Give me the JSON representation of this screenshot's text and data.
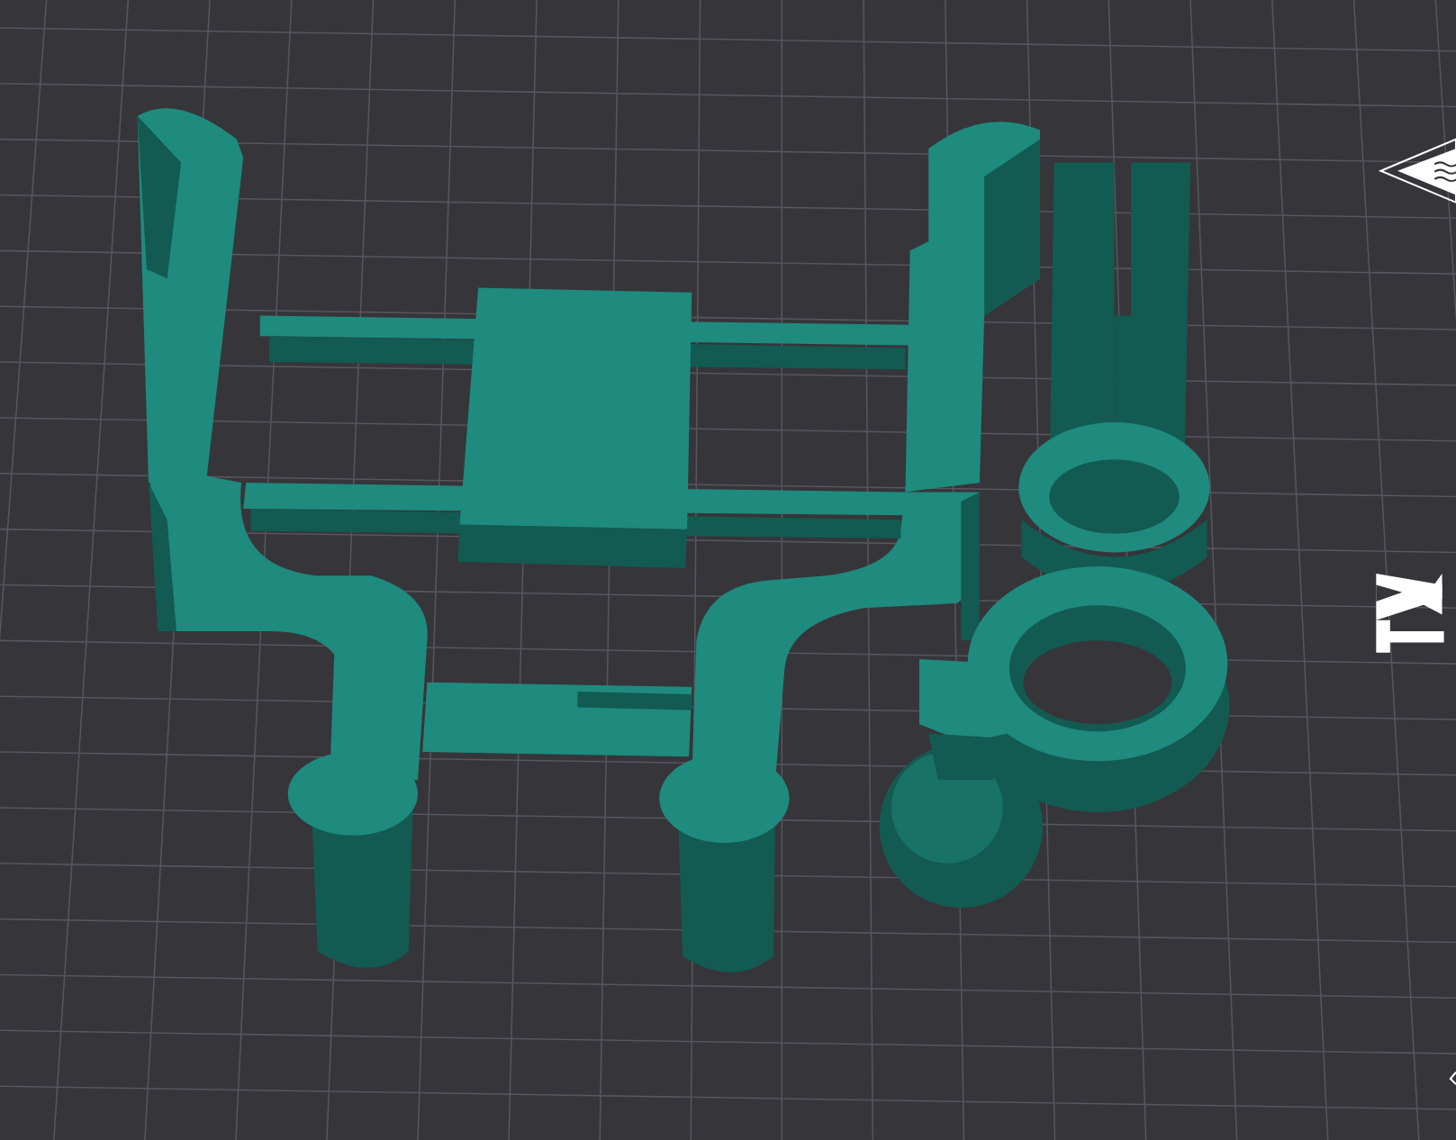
{
  "viewport": {
    "kind": "build-plate"
  }
}
